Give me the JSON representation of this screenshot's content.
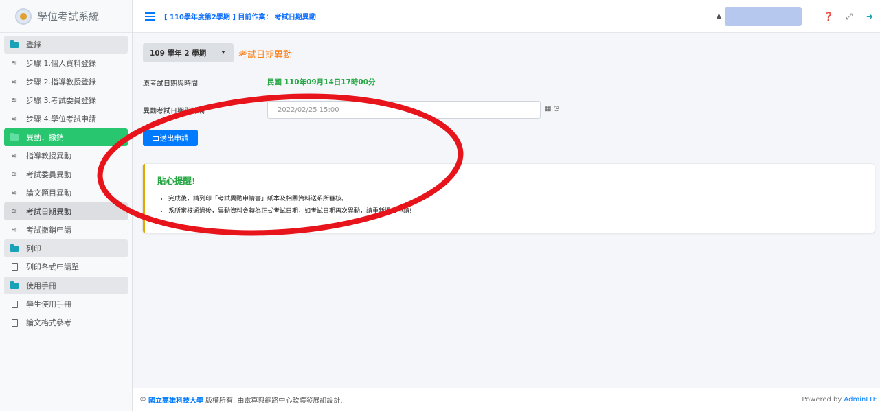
{
  "brand": {
    "name": "學位考試系統"
  },
  "sidebar": {
    "items": [
      {
        "label": "登錄",
        "type": "header",
        "icon": "folder-icon"
      },
      {
        "label": "步驟 1.個人資料登錄",
        "type": "link",
        "icon": "stack-icon"
      },
      {
        "label": "步驟 2.指導教授登錄",
        "type": "link",
        "icon": "stack-icon"
      },
      {
        "label": "步驟 3.考試委員登錄",
        "type": "link",
        "icon": "stack-icon"
      },
      {
        "label": "步驟 4.學位考試申請",
        "type": "link",
        "icon": "stack-icon"
      },
      {
        "label": "異動．撤銷",
        "type": "active-header",
        "icon": "folder-icon"
      },
      {
        "label": "指導教授異動",
        "type": "link",
        "icon": "stack-icon"
      },
      {
        "label": "考試委員異動",
        "type": "link",
        "icon": "stack-icon"
      },
      {
        "label": "論文題目異動",
        "type": "link",
        "icon": "stack-icon"
      },
      {
        "label": "考試日期異動",
        "type": "current",
        "icon": "stack-icon"
      },
      {
        "label": "考試撤銷申請",
        "type": "link",
        "icon": "stack-icon"
      },
      {
        "label": "列印",
        "type": "header",
        "icon": "folder-icon"
      },
      {
        "label": "列印各式申請單",
        "type": "link",
        "icon": "pdf-icon"
      },
      {
        "label": "使用手冊",
        "type": "header",
        "icon": "folder-icon"
      },
      {
        "label": "學生使用手冊",
        "type": "link",
        "icon": "pdf-icon"
      },
      {
        "label": "論文格式參考",
        "type": "link",
        "icon": "pdf-icon"
      }
    ]
  },
  "topbar": {
    "title": "[ 110學年度第2學期 ] 目前作業： 考試日期異動",
    "icons": [
      "user-icon",
      "help-icon",
      "fullscreen-icon",
      "logout-icon"
    ]
  },
  "main": {
    "term_select": "109 學年 2 學期",
    "heading": "考試日期異動",
    "original_label": "原考試日期與時間",
    "original_value": "民國 110年09月14日17時00分",
    "new_label": "異動考試日期與時間",
    "new_value": "2022/02/25 15:00",
    "submit_label": "送出申請"
  },
  "callout": {
    "title": "貼心提醒!",
    "items": [
      "完成後，請列印「考試異動申請書」紙本及相關資料送系所審核。",
      "系所審核通過後，異動資料會轉為正式考試日期，如考試日期再次異動，請重新提出申請!"
    ]
  },
  "footer": {
    "prefix": "©",
    "university": "國立高雄科技大學",
    "suffix": "版權所有. 由電算與網路中心軟體發展組設計.",
    "powered_prefix": "Powered by ",
    "powered_name": "AdminLTE"
  },
  "colors": {
    "accent": "#007bff",
    "active_menu": "#28c76f",
    "heading": "#fd7e14",
    "value_green": "#28a745",
    "callout_border": "#e0a800",
    "annotation": "#e8141c"
  }
}
